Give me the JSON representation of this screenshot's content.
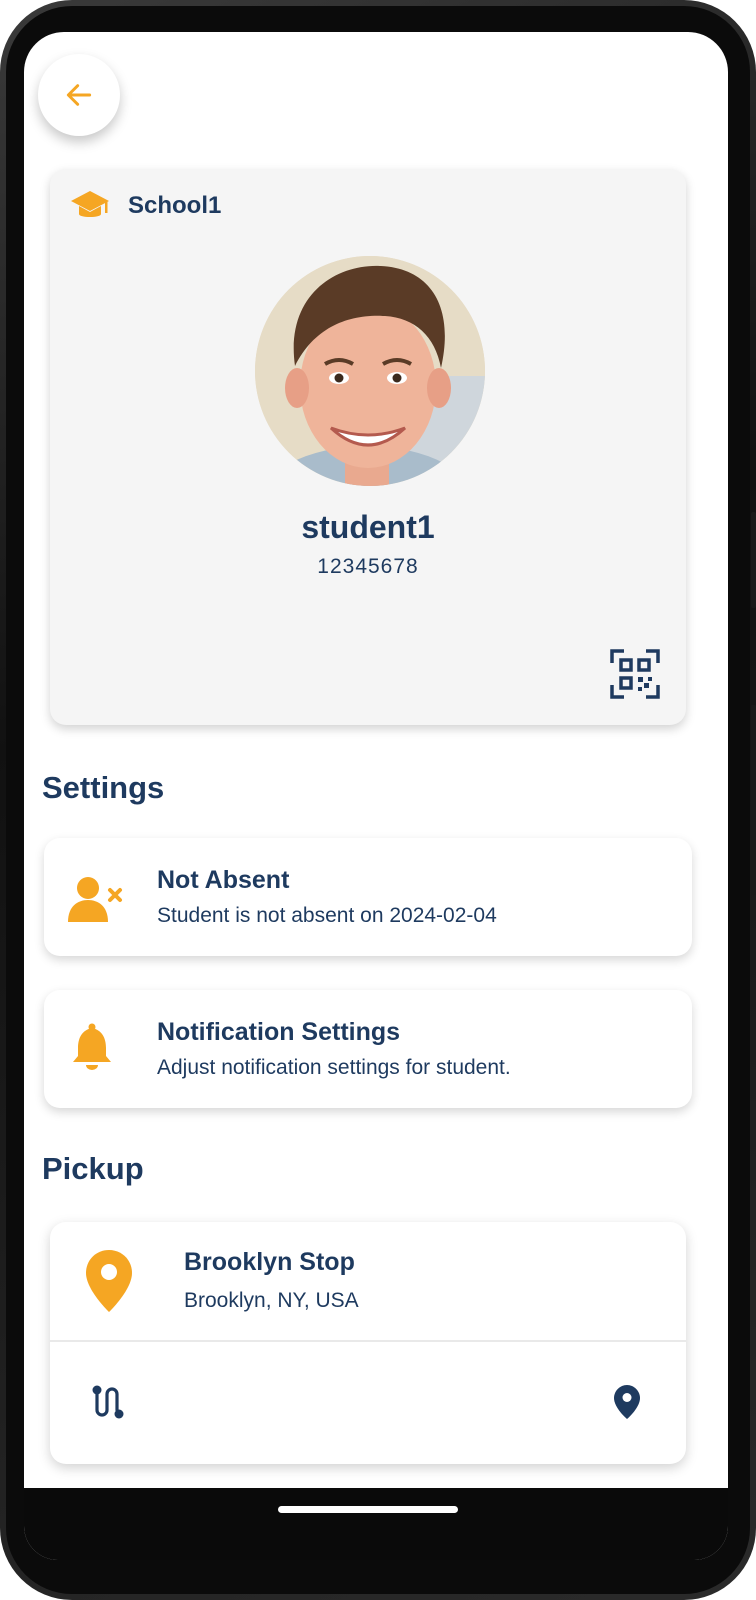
{
  "header": {
    "back_icon": "arrow-left-icon"
  },
  "student_card": {
    "school_icon": "graduation-cap-icon",
    "school_name": "School1",
    "student_name": "student1",
    "student_id": "12345678",
    "qr_icon": "qr-code-scan-icon"
  },
  "settings": {
    "title": "Settings",
    "items": [
      {
        "icon": "user-absent-icon",
        "title": "Not Absent",
        "subtitle": "Student is not absent on 2024-02-04"
      },
      {
        "icon": "bell-icon",
        "title": "Notification Settings",
        "subtitle": "Adjust notification settings for student."
      }
    ]
  },
  "pickup": {
    "title": "Pickup",
    "stop_name": "Brooklyn Stop",
    "stop_address": "Brooklyn, NY, USA",
    "route_icon": "route-icon",
    "location_icon": "map-pin-icon"
  },
  "colors": {
    "accent": "#F5A623",
    "primary_text": "#1E3A5F",
    "card_bg": "#F5F5F5"
  }
}
